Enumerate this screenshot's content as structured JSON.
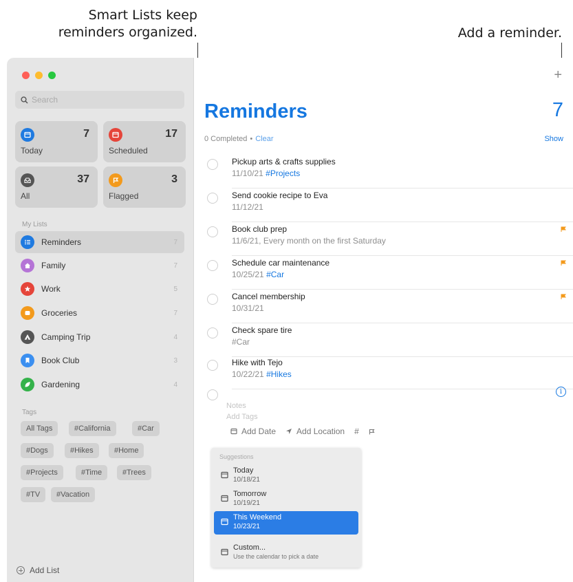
{
  "callouts": {
    "smart_lists": "Smart Lists keep\nreminders organized.",
    "add_reminder": "Add a reminder."
  },
  "sidebar": {
    "search_placeholder": "Search",
    "smart_lists": [
      {
        "name": "Today",
        "count": "7",
        "color": "#1f7ae0",
        "icon": "calendar-icon"
      },
      {
        "name": "Scheduled",
        "count": "17",
        "color": "#e5453a",
        "icon": "calendar-icon"
      },
      {
        "name": "All",
        "count": "37",
        "color": "#555555",
        "icon": "tray-icon"
      },
      {
        "name": "Flagged",
        "count": "3",
        "color": "#f39a1c",
        "icon": "flag-icon"
      }
    ],
    "my_lists_label": "My Lists",
    "lists": [
      {
        "name": "Reminders",
        "count": "7",
        "color": "#1f7ae0",
        "icon": "list-icon"
      },
      {
        "name": "Family",
        "count": "7",
        "color": "#b574d6",
        "icon": "house-icon"
      },
      {
        "name": "Work",
        "count": "5",
        "color": "#e5453a",
        "icon": "star-icon"
      },
      {
        "name": "Groceries",
        "count": "7",
        "color": "#f39a1c",
        "icon": "cart-icon"
      },
      {
        "name": "Camping Trip",
        "count": "4",
        "color": "#555555",
        "icon": "tent-icon"
      },
      {
        "name": "Book Club",
        "count": "3",
        "color": "#3b8ff0",
        "icon": "bookmark-icon"
      },
      {
        "name": "Gardening",
        "count": "4",
        "color": "#34b24a",
        "icon": "leaf-icon"
      }
    ],
    "tags_label": "Tags",
    "tags": [
      "All Tags",
      "#California",
      "#Car",
      "#Dogs",
      "#Hikes",
      "#Home",
      "#Projects",
      "#Time",
      "#Trees",
      "#TV",
      "#Vacation"
    ],
    "add_list": "Add List"
  },
  "main": {
    "title": "Reminders",
    "count": "7",
    "completed": "0 Completed",
    "separator": "•",
    "clear": "Clear",
    "show": "Show",
    "reminders": [
      {
        "title": "Pickup arts & crafts supplies",
        "date": "11/10/21",
        "tag": "#Projects",
        "flagged": false
      },
      {
        "title": "Send cookie recipe to Eva",
        "date": "11/12/21",
        "tag": "",
        "flagged": false
      },
      {
        "title": "Book club prep",
        "date": "11/6/21, Every month on the first Saturday",
        "tag": "",
        "flagged": true
      },
      {
        "title": "Schedule car maintenance",
        "date": "10/25/21",
        "tag": "#Car",
        "flagged": true
      },
      {
        "title": "Cancel membership",
        "date": "10/31/21",
        "tag": "",
        "flagged": true
      },
      {
        "title": "Check spare tire",
        "date": "",
        "tag": "#Car",
        "flagged": false
      },
      {
        "title": "Hike with Tejo",
        "date": "10/22/21",
        "tag": "#Hikes",
        "flagged": false
      }
    ],
    "new_reminder": {
      "notes_placeholder": "Notes",
      "tags_placeholder": "Add Tags",
      "add_date": "Add Date",
      "add_location": "Add Location",
      "tag_button": "#"
    },
    "suggestions": {
      "header": "Suggestions",
      "options": [
        {
          "label": "Today",
          "date": "10/18/21",
          "selected": false
        },
        {
          "label": "Tomorrow",
          "date": "10/19/21",
          "selected": false
        },
        {
          "label": "This Weekend",
          "date": "10/23/21",
          "selected": true
        },
        {
          "label": "Custom...",
          "date": "Use the calendar to pick a date",
          "selected": false
        }
      ]
    }
  }
}
